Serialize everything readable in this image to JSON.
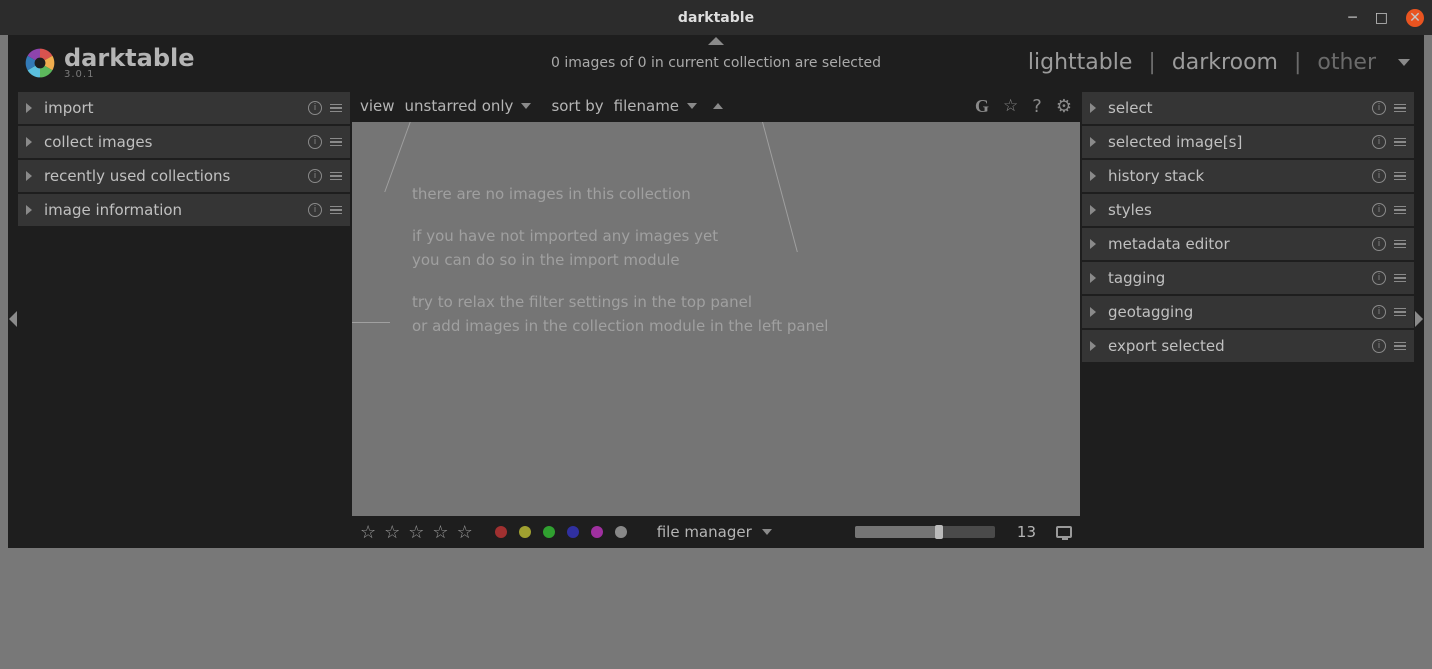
{
  "window": {
    "title": "darktable"
  },
  "brand": {
    "name": "darktable",
    "version": "3.0.1"
  },
  "header": {
    "status": "0 images of 0 in current collection are selected",
    "views": {
      "lighttable": "lighttable",
      "darkroom": "darkroom",
      "other": "other",
      "sep": "|"
    }
  },
  "left_panel": {
    "modules": [
      "import",
      "collect images",
      "recently used collections",
      "image information"
    ]
  },
  "right_panel": {
    "modules": [
      "select",
      "selected image[s]",
      "history stack",
      "styles",
      "metadata editor",
      "tagging",
      "geotagging",
      "export selected"
    ]
  },
  "toolbar": {
    "view_label": "view",
    "view_value": "unstarred only",
    "sort_label": "sort by",
    "sort_value": "filename"
  },
  "viewport": {
    "msg1": "there are no images in this collection",
    "msg2": "if you have not imported any images yet\nyou can do so in the import module",
    "msg3": "try to relax the filter settings in the top panel\nor add images in the collection module in the left panel"
  },
  "bottombar": {
    "layout_value": "file manager",
    "zoom": "13"
  }
}
